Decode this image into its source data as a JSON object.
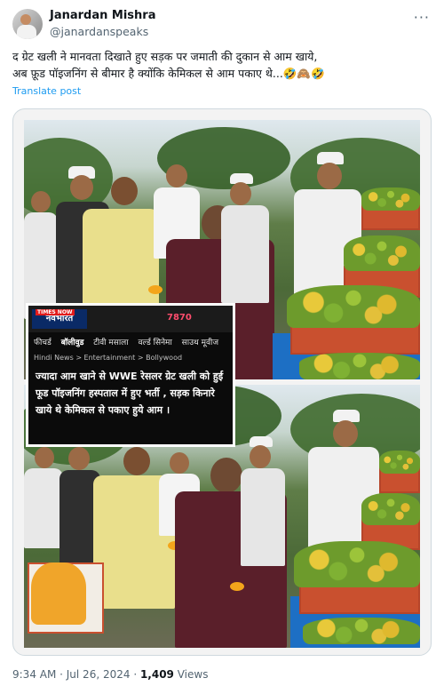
{
  "tweet": {
    "author_name": "Janardan Mishra",
    "author_handle": "@janardanspeaks",
    "more_glyph": "···",
    "text_line1": "द ग्रेट खली ने मानवता दिखाते हुए सड़क पर जमाती की दुकान से आम खाये,",
    "text_line2": "अब फ़ूड पॉइजनिंग से बीमार है क्योंकि केमिकल से आम पकाए थे...🤣🙈🤣",
    "translate_label": "Translate post",
    "time": "9:34 AM · Jul 26, 2024 · ",
    "views_count": "1,409",
    "views_label": " Views"
  },
  "news_card": {
    "brand_badge": "TIMES NOW",
    "brand": "नवभारत",
    "views": "7870",
    "tabs": [
      "फीचर्ड",
      "बॉलीवुड",
      "टीवी मसाला",
      "वर्ल्ड सिनेमा",
      "साउथ मूवीज"
    ],
    "active_tab": 1,
    "breadcrumb": "Hindi News  >  Entertainment  >  Bollywood",
    "headline": "ज्यादा आम खाने से WWE रेसलर ग्रेट खली को हुई फूड पॉइजनिंग हस्पताल में हुए भर्ती , सड़क किनारे खाये थे केमिकल से पकाए हुये आम ।"
  },
  "colors": {
    "link": "#1d9bf0",
    "muted": "#536471",
    "text": "#0f1419",
    "news_views": "#ff4d6d"
  }
}
